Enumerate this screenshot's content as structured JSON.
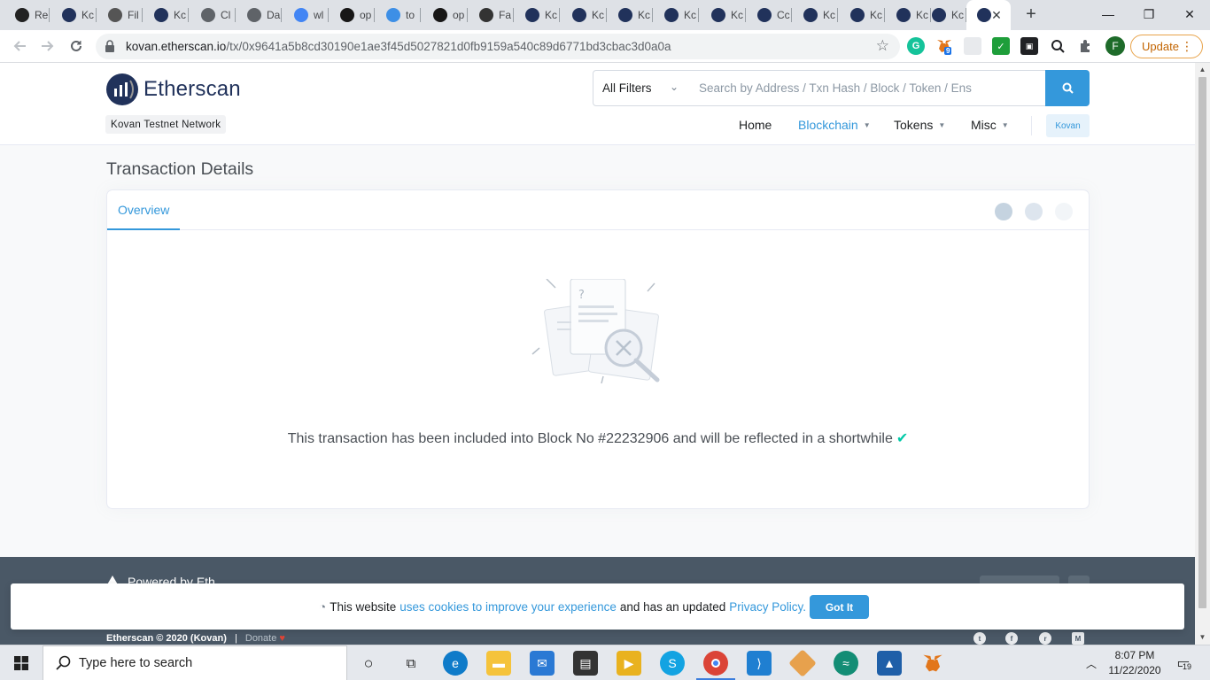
{
  "browser": {
    "tabs": [
      {
        "label": "Re",
        "color": "#222"
      },
      {
        "label": "Kc",
        "color": "#21325b"
      },
      {
        "label": "Fil",
        "color": "#555"
      },
      {
        "label": "Kc",
        "color": "#21325b"
      },
      {
        "label": "Cl",
        "color": "#5f6368"
      },
      {
        "label": "Da",
        "color": "#5f6368"
      },
      {
        "label": "wl",
        "color": "#4285f4"
      },
      {
        "label": "op",
        "color": "#181717"
      },
      {
        "label": "to",
        "color": "#3d8fe6"
      },
      {
        "label": "op",
        "color": "#181717"
      },
      {
        "label": "Fa",
        "color": "#333"
      },
      {
        "label": "Kc",
        "color": "#21325b"
      },
      {
        "label": "Kc",
        "color": "#21325b"
      },
      {
        "label": "Kc",
        "color": "#21325b"
      },
      {
        "label": "Kc",
        "color": "#21325b"
      },
      {
        "label": "Kc",
        "color": "#21325b"
      },
      {
        "label": "Cc",
        "color": "#21325b"
      },
      {
        "label": "Kc",
        "color": "#21325b"
      },
      {
        "label": "Kc",
        "color": "#21325b"
      },
      {
        "label": "Kc",
        "color": "#21325b"
      },
      {
        "label": "Kc",
        "color": "#21325b"
      }
    ],
    "active_tab_close": "✕",
    "new_tab": "+",
    "window": {
      "minimize": "—",
      "maximize": "❐",
      "close": "✕"
    },
    "url_host": "kovan.etherscan.io",
    "url_path": "/tx/0x9641a5b8cd30190e1ae3f45d5027821d0fb9159a540c89d6771bd3cbac3d0a0a",
    "star": "☆",
    "metamask_badge": "9",
    "profile_initial": "F",
    "update_label": "Update",
    "menu_dots": "⋮"
  },
  "site": {
    "logo_text": "Etherscan",
    "network_label": "Kovan Testnet Network",
    "search": {
      "filter_label": "All Filters",
      "placeholder": "Search by Address / Txn Hash / Block / Token / Ens"
    },
    "nav": {
      "home": "Home",
      "blockchain": "Blockchain",
      "tokens": "Tokens",
      "misc": "Misc",
      "network_pill": "Kovan"
    },
    "page_title": "Transaction Details",
    "card": {
      "tab_overview": "Overview",
      "message": "This transaction has been included into Block No #22232906 and will be reflected in a shortwhile",
      "check": "✔"
    },
    "footer": {
      "powered": "Powered by Eth",
      "copyright": "Etherscan © 2020 (Kovan)",
      "separator": "|",
      "donate": "Donate",
      "heart": "♥"
    },
    "cookie": {
      "prefix": "This website",
      "link1": "uses cookies to improve your experience",
      "middle": "and has an updated",
      "link2": "Privacy Policy.",
      "button": "Got It"
    }
  },
  "taskbar": {
    "search_placeholder": "Type here to search",
    "time": "8:07 PM",
    "date": "11/22/2020",
    "notifications": "19"
  },
  "colors": {
    "accent": "#3498db",
    "brand": "#21325b",
    "success": "#00c9a7",
    "footer_bg": "#4a5866"
  }
}
